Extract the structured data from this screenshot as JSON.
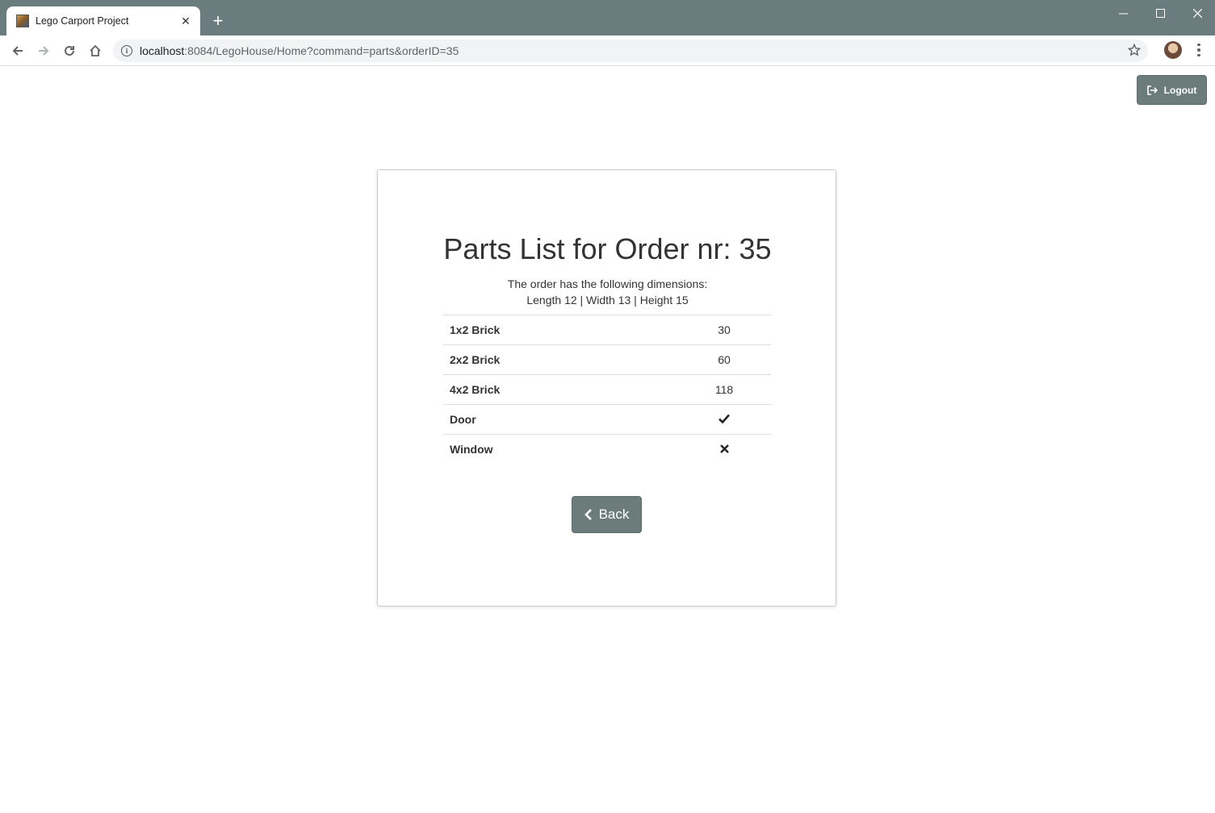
{
  "browser": {
    "tab_title": "Lego Carport Project",
    "url_host": "localhost",
    "url_rest": ":8084/LegoHouse/Home?command=parts&orderID=35"
  },
  "page": {
    "logout_label": "Logout",
    "title": "Parts List for Order nr: 35",
    "dims_line1": "The order has the following dimensions:",
    "dims_line2": "Length 12 | Width 13 | Height 15",
    "back_label": "Back"
  },
  "parts": [
    {
      "name": "1x2 Brick",
      "value": "30"
    },
    {
      "name": "2x2 Brick",
      "value": "60"
    },
    {
      "name": "4x2 Brick",
      "value": "118"
    },
    {
      "name": "Door",
      "icon": "check-icon"
    },
    {
      "name": "Window",
      "icon": "cross-icon"
    }
  ],
  "colors": {
    "titlebar": "#6b7c7e",
    "button": "#6b7c7a"
  }
}
